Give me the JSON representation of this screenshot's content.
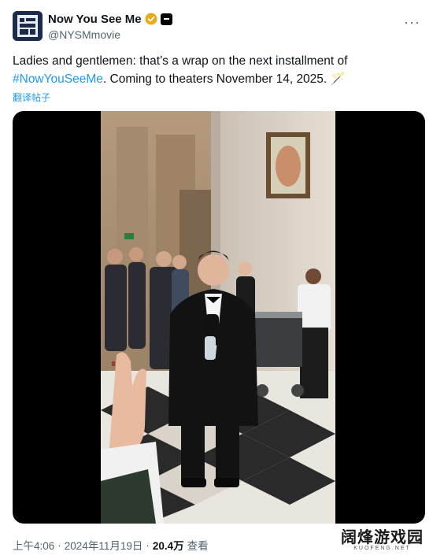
{
  "account": {
    "display_name": "Now You See Me",
    "handle": "@NYSMmovie",
    "avatar_text": "NOW YOU SEE ME"
  },
  "tweet": {
    "text_before": "Ladies and gentlemen: that’s a wrap on the next installment of ",
    "hashtag": "#NowYouSeeMe",
    "text_after": ". Coming to theaters November 14, 2025. ",
    "emoji": "🪄",
    "translate_label": "翻译帖子"
  },
  "media": {
    "type": "video"
  },
  "meta": {
    "time": "上午4:06",
    "separator": "·",
    "date": "2024年11月19日",
    "views_count": "20.4万",
    "views_label": "查看"
  },
  "watermark": {
    "main": "阔烽游戏园",
    "sub": "KUOFENG.NET"
  },
  "colors": {
    "link": "#1d9bf0",
    "secondary_text": "#536471",
    "verified": "#e8a91b"
  }
}
